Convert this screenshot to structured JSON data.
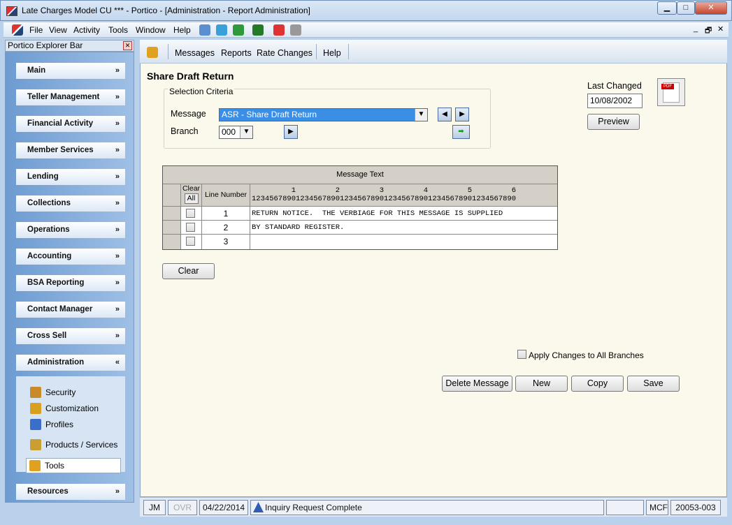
{
  "window": {
    "title": "Late Charges Model CU *** - Portico - [Administration - Report Administration]",
    "minimize": "▁",
    "maximize": "□",
    "close": "✕"
  },
  "menubar": {
    "items": [
      "File",
      "View",
      "Activity",
      "Tools",
      "Window",
      "Help"
    ],
    "mdi": [
      "_",
      "🗗",
      "✕"
    ]
  },
  "explorer": {
    "title": "Portico Explorer Bar",
    "groups": [
      "Main",
      "Teller Management",
      "Financial Activity",
      "Member Services",
      "Lending",
      "Collections",
      "Operations",
      "Accounting",
      "BSA Reporting",
      "Contact Manager",
      "Cross Sell",
      "Administration"
    ],
    "admin_items": [
      "Security",
      "Customization",
      "Profiles",
      "Products / Services",
      "Tools"
    ],
    "resources": "Resources",
    "collapsed_chev": "»",
    "expanded_chev": "«"
  },
  "toolbar": {
    "items": [
      "Messages",
      "Reports",
      "Rate Changes",
      "Help"
    ]
  },
  "page": {
    "title": "Share Draft Return",
    "selection_legend": "Selection Criteria",
    "message_label": "Message",
    "message_value": "ASR - Share Draft Return",
    "branch_label": "Branch",
    "branch_value": "000",
    "last_changed_label": "Last Changed",
    "last_changed_value": "10/08/2002",
    "preview": "Preview",
    "pdf_label": "PDF"
  },
  "grid": {
    "header": "Message Text",
    "clear_label": "Clear",
    "all_label": "All",
    "line_number": "Line Number",
    "ruler1": "         1         2         3         4         5         6",
    "ruler2": "123456789012345678901234567890123456789012345678901234567890",
    "rows": [
      {
        "n": "1",
        "text": "RETURN NOTICE.  THE VERBIAGE FOR THIS MESSAGE IS SUPPLIED"
      },
      {
        "n": "2",
        "text": "BY STANDARD REGISTER."
      },
      {
        "n": "3",
        "text": ""
      }
    ]
  },
  "buttons": {
    "clear": "Clear",
    "delete": "Delete Message",
    "new": "New",
    "copy": "Copy",
    "save": "Save",
    "apply_all": "Apply Changes to All Branches"
  },
  "status": {
    "user": "JM",
    "ovr": "OVR",
    "date": "04/22/2014",
    "message": "Inquiry Request Complete",
    "mcf": "MCF",
    "code": "20053-003"
  }
}
